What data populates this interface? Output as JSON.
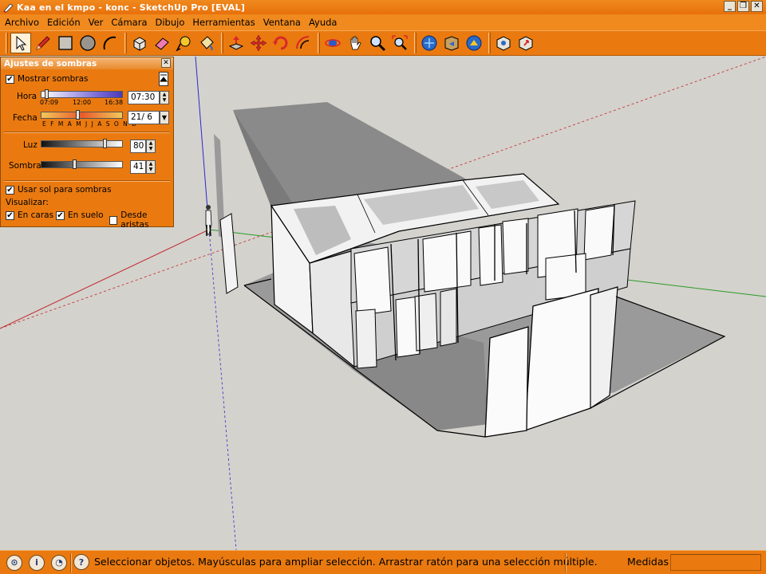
{
  "window": {
    "title": "Kaa en el kmpo - konc - SketchUp Pro [EVAL]",
    "buttons": [
      "_",
      "❐",
      "✕"
    ]
  },
  "menu": [
    "Archivo",
    "Edición",
    "Ver",
    "Cámara",
    "Dibujo",
    "Herramientas",
    "Ventana",
    "Ayuda"
  ],
  "toolbar": {
    "groups": [
      [
        "select-icon",
        "pencil-icon",
        "rectangle-icon",
        "circle-icon",
        "arc-icon"
      ],
      [
        "make-component-icon",
        "eraser-icon",
        "tape-measure-icon",
        "paint-bucket-icon"
      ],
      [
        "push-pull-icon",
        "move-icon",
        "rotate-icon",
        "offset-icon"
      ],
      [
        "orbit-icon",
        "pan-icon",
        "zoom-icon",
        "zoom-extents-icon"
      ],
      [
        "get-models-icon",
        "share-model-icon",
        "3d-warehouse-icon"
      ],
      [
        "component-library-icon",
        "share-component-icon"
      ]
    ],
    "accent": "#ea7a10"
  },
  "shadow_settings": {
    "title": "Ajustes de sombras",
    "close": "✕",
    "show_shadows_label": "Mostrar sombras",
    "show_shadows": true,
    "time_label": "Hora",
    "time_ticks": [
      "07:09",
      "12:00",
      "16:38"
    ],
    "time_value": "07:30",
    "time_fraction": 0.04,
    "date_label": "Fecha",
    "months": "E F M A M J J A S O N D",
    "date_value": "21/ 6",
    "date_fraction": 0.45,
    "light_label": "Luz",
    "light_value": "80",
    "light_fraction": 0.8,
    "dark_label": "Sombra",
    "dark_value": "41",
    "dark_fraction": 0.41,
    "use_sun_label": "Usar sol para sombras",
    "use_sun": true,
    "display_label": "Visualizar:",
    "on_faces_label": "En caras",
    "on_faces": true,
    "on_ground_label": "En suelo",
    "on_ground": true,
    "from_edges_label": "Desde aristas",
    "from_edges": false
  },
  "status": {
    "icons": [
      "geo-location-icon",
      "credits-icon",
      "user-icon",
      "help-icon"
    ],
    "message": "Seleccionar objetos. Mayúsculas para ampliar selección. Arrastrar ratón para una selección múltiple.",
    "measures_label": "Medidas",
    "measures_value": ""
  }
}
